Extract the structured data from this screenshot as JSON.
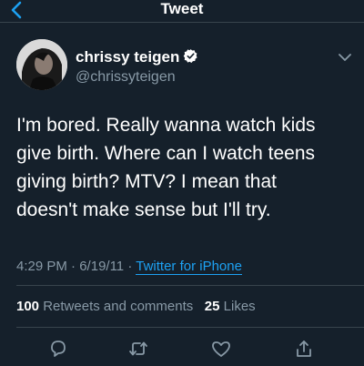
{
  "header": {
    "title": "Tweet",
    "back_icon": "chevron-left-icon"
  },
  "author": {
    "name": "chrissy teigen",
    "handle": "@chrissyteigen",
    "verified_icon": "verified-badge-icon",
    "menu_icon": "chevron-down-icon"
  },
  "tweet": {
    "text": "I'm bored. Really wanna watch kids\ngive birth. Where can I watch teens\ngiving birth? MTV? I mean that\ndoesn't make sense but I'll try.",
    "time": "4:29 PM",
    "separator": "·",
    "date": "6/19/11",
    "source": "Twitter for iPhone"
  },
  "stats": {
    "retweets_count": "100",
    "retweets_label": "Retweets and comments",
    "likes_count": "25",
    "likes_label": "Likes"
  },
  "actions": [
    {
      "name": "reply",
      "icon": "comment-icon"
    },
    {
      "name": "retweet",
      "icon": "retweet-icon"
    },
    {
      "name": "like",
      "icon": "heart-icon"
    },
    {
      "name": "share",
      "icon": "share-icon"
    }
  ],
  "colors": {
    "background": "#15202b",
    "text": "#ffffff",
    "secondary": "#8899a6",
    "accent": "#1da1f2",
    "divider": "#38444d"
  }
}
